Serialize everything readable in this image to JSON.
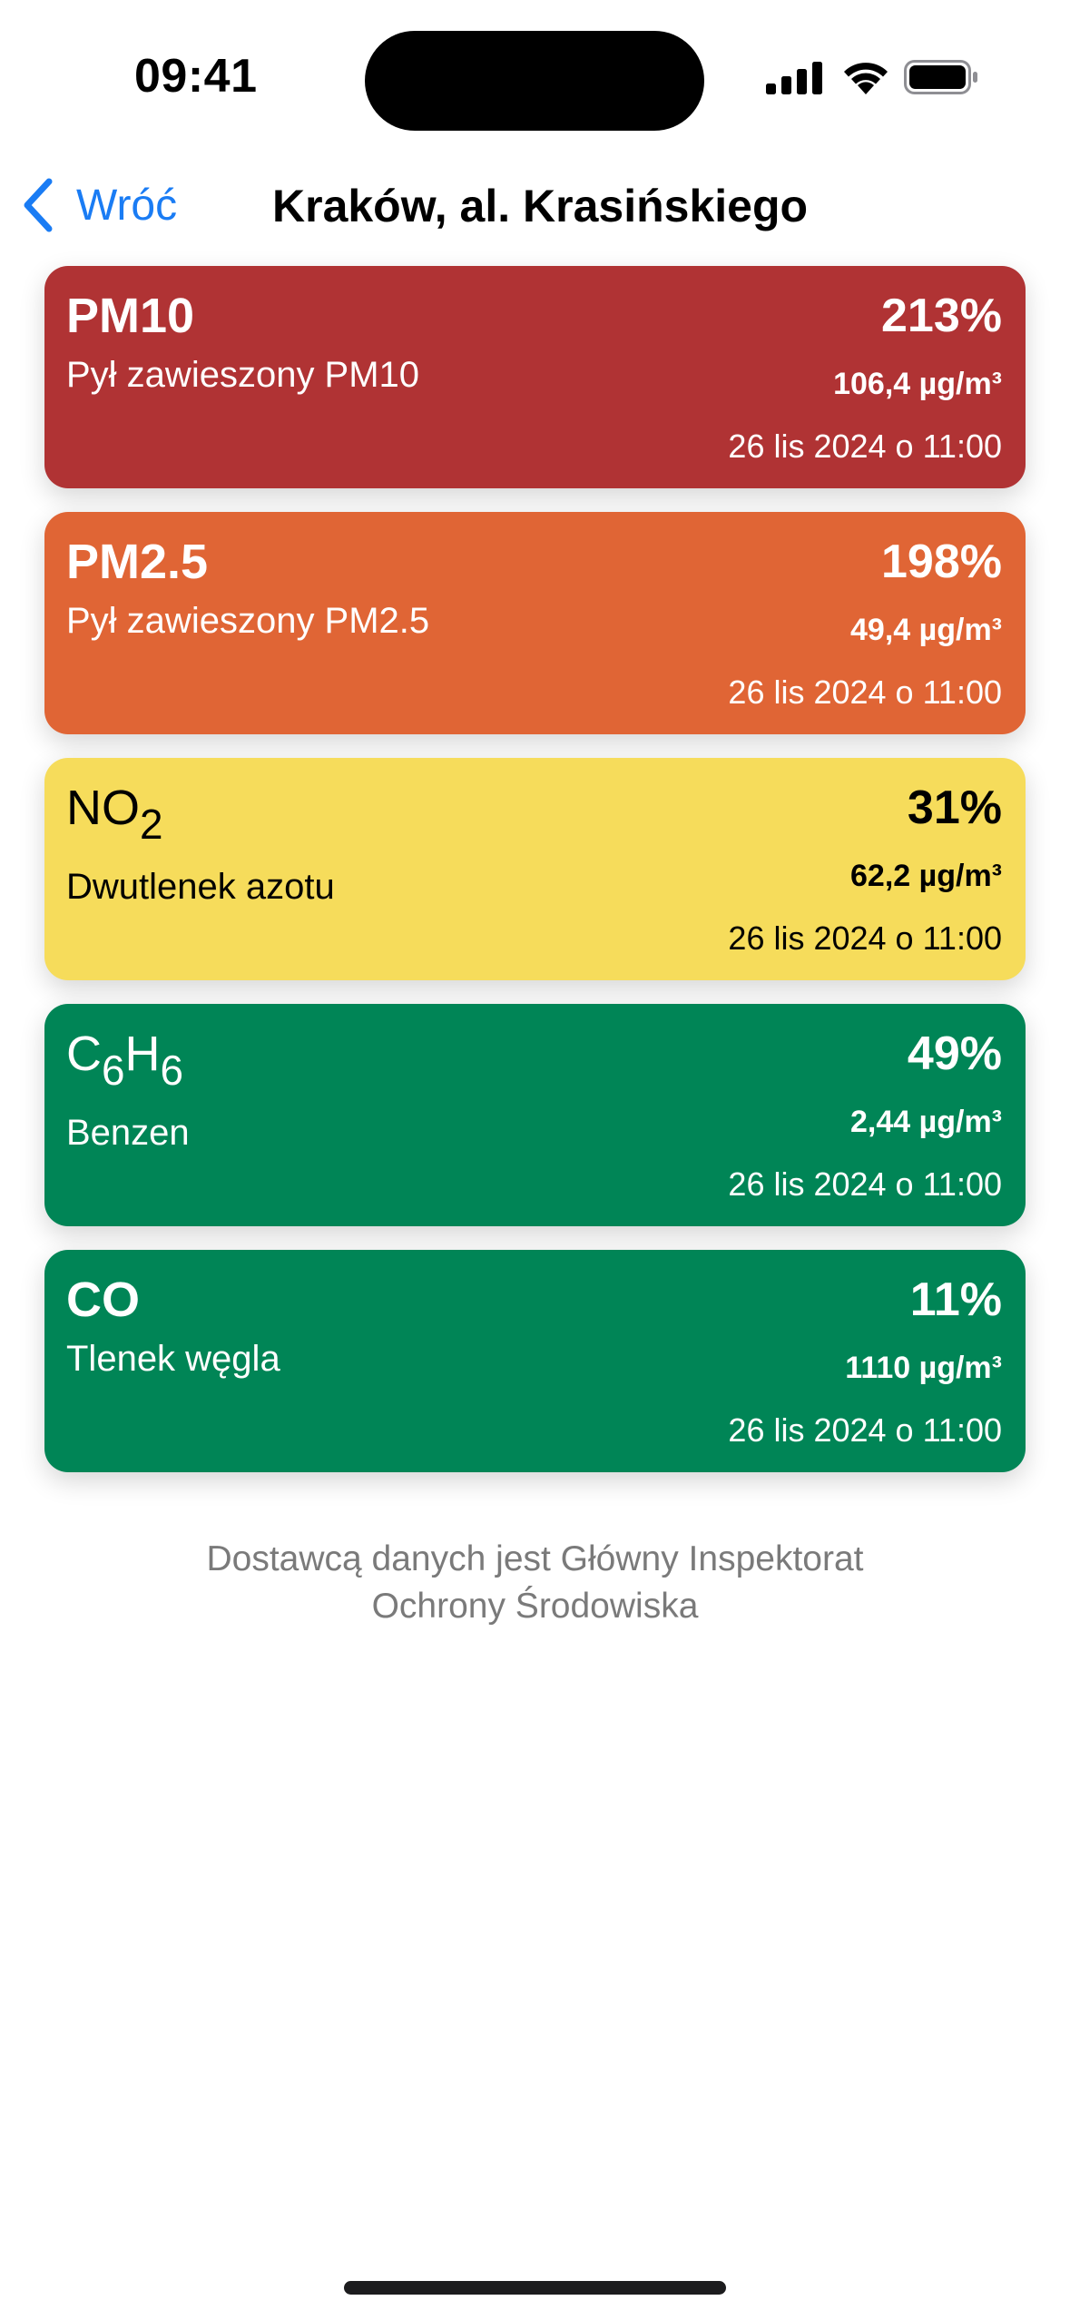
{
  "status_bar": {
    "time": "09:41",
    "icons": [
      "cellular-signal-icon",
      "wifi-icon",
      "battery-icon"
    ]
  },
  "nav": {
    "back_label": "Wróć",
    "back_icon": "chevron-left-icon",
    "title": "Kraków, al. Krasińskiego",
    "accent_color": "#1a7cf4"
  },
  "pollutants": [
    {
      "code": "PM10",
      "name": "Pył zawieszony PM10",
      "percent": "213%",
      "concentration": "106,4 µg/m³",
      "timestamp": "26 lis 2024 o 11:00",
      "color": "#b03334"
    },
    {
      "code": "PM2.5",
      "name": "Pył zawieszony PM2.5",
      "percent": "198%",
      "concentration": "49,4 µg/m³",
      "timestamp": "26 lis 2024 o 11:00",
      "color": "#e06535"
    },
    {
      "code_base": "NO",
      "code_sub": "2",
      "name": "Dwutlenek azotu",
      "percent": "31%",
      "concentration": "62,2 µg/m³",
      "timestamp": "26 lis 2024 o 11:00",
      "color": "#f6dc5b"
    },
    {
      "code_parts": [
        "C",
        "6",
        "H",
        "6"
      ],
      "name": "Benzen",
      "percent": "49%",
      "concentration": "2,44 µg/m³",
      "timestamp": "26 lis 2024 o 11:00",
      "color": "#008556"
    },
    {
      "code": "CO",
      "name": "Tlenek węgla",
      "percent": "11%",
      "concentration": "1110 µg/m³",
      "timestamp": "26 lis 2024 o 11:00",
      "color": "#008556"
    }
  ],
  "footer": {
    "line1": "Dostawcą danych jest Główny Inspektorat",
    "line2": "Ochrony Środowiska"
  }
}
